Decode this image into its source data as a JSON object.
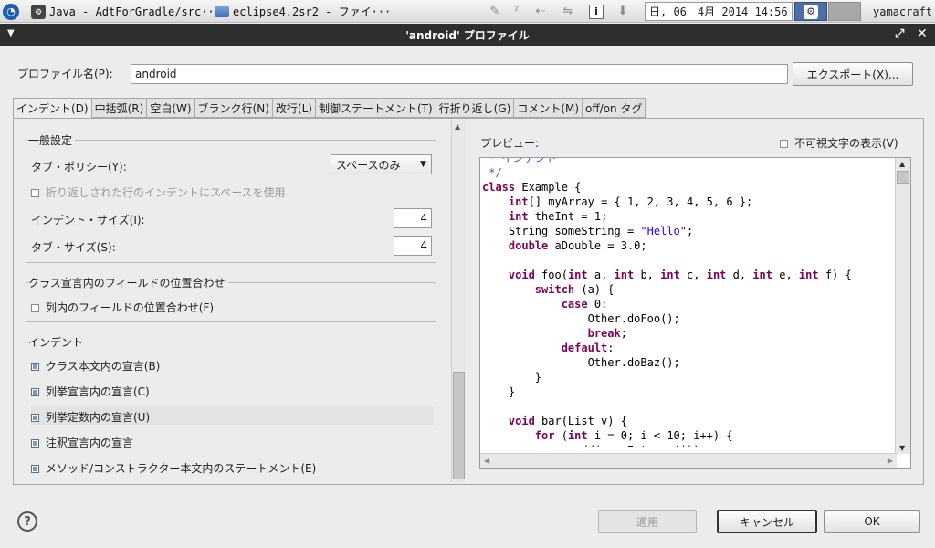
{
  "taskbar": {
    "start_icon": "ubuntu-style-launcher",
    "task1": "Java - AdtForGradle/src···",
    "task2": "eclipse4.2sr2 - ファイ···",
    "clock": "日, 06　4月 2014 14:56",
    "user": "yamacraft"
  },
  "dialog": {
    "title": "'android' プロファイル",
    "profile_label": "プロファイル名(P):",
    "profile_value": "android",
    "export_label": "エクスポート(X)..."
  },
  "tabs": [
    {
      "label": "インデント(D)",
      "active": true
    },
    {
      "label": "中括弧(R)",
      "active": false
    },
    {
      "label": "空白(W)",
      "active": false
    },
    {
      "label": "ブランク行(N)",
      "active": false
    },
    {
      "label": "改行(L)",
      "active": false
    },
    {
      "label": "制御ステートメント(T)",
      "active": false
    },
    {
      "label": "行折り返し(G)",
      "active": false
    },
    {
      "label": "コメント(M)",
      "active": false
    },
    {
      "label": "off/on タグ",
      "active": false
    }
  ],
  "general": {
    "title": "一般設定",
    "tab_policy_label": "タブ・ポリシー(Y):",
    "tab_policy_value": "スペースのみ",
    "wrap_indent_label": "折り返しされた行のインデントにスペースを使用",
    "indent_size_label": "インデント・サイズ(I):",
    "indent_size_value": "4",
    "tab_size_label": "タブ・サイズ(S):",
    "tab_size_value": "4"
  },
  "align": {
    "title": "クラス宣言内のフィールドの位置合わせ",
    "columns_label": "列内のフィールドの位置合わせ(F)"
  },
  "indent": {
    "title": "インデント",
    "items": [
      {
        "label": "クラス本文内の宣言(B)",
        "checked": true
      },
      {
        "label": "列挙宣言内の宣言(C)",
        "checked": true
      },
      {
        "label": "列挙定数内の宣言(U)",
        "checked": true
      },
      {
        "label": "注釈宣言内の宣言",
        "checked": true
      },
      {
        "label": "メソッド/コンストラクター本文内のステートメント(E)",
        "checked": true
      }
    ]
  },
  "preview": {
    "label": "プレビュー:",
    "show_invisible_label": "不可視文字の表示(V)",
    "lines": [
      [
        [
          "cm",
          " * インデント"
        ]
      ],
      [
        [
          "cm",
          " */"
        ]
      ],
      [
        [
          "kw",
          "class"
        ],
        [
          "",
          " Example {"
        ]
      ],
      [
        [
          "",
          "    "
        ],
        [
          "kw",
          "int"
        ],
        [
          "",
          "[] myArray = { 1, 2, 3, 4, 5, 6 };"
        ]
      ],
      [
        [
          "",
          "    "
        ],
        [
          "kw",
          "int"
        ],
        [
          "",
          " theInt = 1;"
        ]
      ],
      [
        [
          "",
          "    String someString = "
        ],
        [
          "st",
          "\"Hello\""
        ],
        [
          "",
          ";"
        ]
      ],
      [
        [
          "",
          "    "
        ],
        [
          "kw",
          "double"
        ],
        [
          "",
          " aDouble = 3.0;"
        ]
      ],
      [
        [
          "",
          ""
        ]
      ],
      [
        [
          "",
          "    "
        ],
        [
          "kw",
          "void"
        ],
        [
          "",
          " foo("
        ],
        [
          "kw",
          "int"
        ],
        [
          "",
          " a, "
        ],
        [
          "kw",
          "int"
        ],
        [
          "",
          " b, "
        ],
        [
          "kw",
          "int"
        ],
        [
          "",
          " c, "
        ],
        [
          "kw",
          "int"
        ],
        [
          "",
          " d, "
        ],
        [
          "kw",
          "int"
        ],
        [
          "",
          " e, "
        ],
        [
          "kw",
          "int"
        ],
        [
          "",
          " f) {"
        ]
      ],
      [
        [
          "",
          "        "
        ],
        [
          "kw",
          "switch"
        ],
        [
          "",
          " (a) {"
        ]
      ],
      [
        [
          "",
          "            "
        ],
        [
          "kw",
          "case"
        ],
        [
          "",
          " 0:"
        ]
      ],
      [
        [
          "",
          "                Other.doFoo();"
        ]
      ],
      [
        [
          "",
          "                "
        ],
        [
          "kw",
          "break"
        ],
        [
          "",
          ";"
        ]
      ],
      [
        [
          "",
          "            "
        ],
        [
          "kw",
          "default"
        ],
        [
          "",
          ":"
        ]
      ],
      [
        [
          "",
          "                Other.doBaz();"
        ]
      ],
      [
        [
          "",
          "        }"
        ]
      ],
      [
        [
          "",
          "    }"
        ]
      ],
      [
        [
          "",
          ""
        ]
      ],
      [
        [
          "",
          "    "
        ],
        [
          "kw",
          "void"
        ],
        [
          "",
          " bar(List v) {"
        ]
      ],
      [
        [
          "",
          "        "
        ],
        [
          "kw",
          "for"
        ],
        [
          "",
          " ("
        ],
        [
          "kw",
          "int"
        ],
        [
          "",
          " i = 0; i < 10; i++) {"
        ]
      ],
      [
        [
          "",
          "            v.add(new Integer(i));"
        ]
      ]
    ]
  },
  "buttons": {
    "apply": "適用",
    "cancel": "キャンセル",
    "ok": "OK"
  },
  "colors": {
    "keyword": "#7f0055",
    "comment": "#3f5fbf",
    "string": "#2a00ff",
    "titlebar": "#2e2e2e"
  }
}
